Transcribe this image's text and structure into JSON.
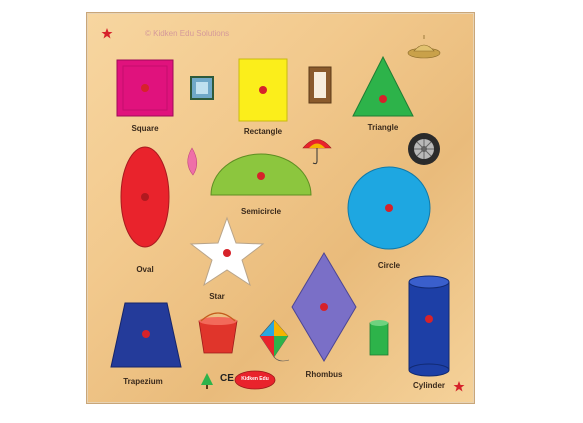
{
  "board": {
    "brand_text": "© Kidken Edu Solutions",
    "badge_text": "Kidken Edu",
    "ce_mark": "CE",
    "colors": {
      "wood": "#f2c98d",
      "square": "#e0127d",
      "rectangle": "#fbee1b",
      "triangle": "#2db34a",
      "oval": "#e9232c",
      "semicircle": "#8cc63e",
      "circle": "#1ea7e1",
      "star": "#ffffff",
      "rhombus": "#7a6fc7",
      "trapezium": "#243b9a",
      "cylinder": "#1d3fa6",
      "knob": "#d6222a"
    },
    "shapes": [
      {
        "name": "square",
        "label": "Square"
      },
      {
        "name": "rectangle",
        "label": "Rectangle"
      },
      {
        "name": "triangle",
        "label": "Triangle"
      },
      {
        "name": "oval",
        "label": "Oval"
      },
      {
        "name": "semicircle",
        "label": "Semicircle"
      },
      {
        "name": "circle",
        "label": "Circle"
      },
      {
        "name": "star",
        "label": "Star"
      },
      {
        "name": "rhombus",
        "label": "Rhombus"
      },
      {
        "name": "trapezium",
        "label": "Trapezium"
      },
      {
        "name": "cylinder",
        "label": "Cylinder"
      }
    ]
  }
}
